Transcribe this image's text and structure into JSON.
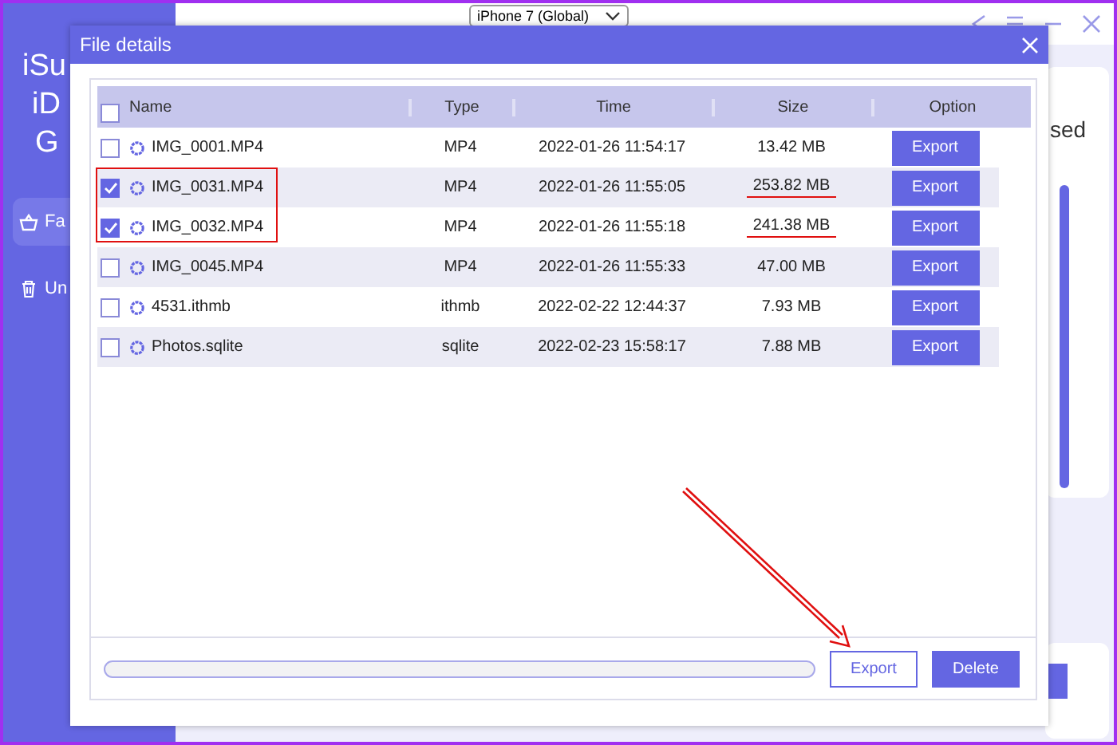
{
  "app": {
    "title_lines": [
      "iSu",
      "iD",
      "G"
    ],
    "sidebar": {
      "items": [
        {
          "label": "Fa",
          "kind": "basket",
          "selected": true
        },
        {
          "label": "Un",
          "kind": "trash",
          "selected": false
        }
      ]
    },
    "device_select": {
      "value": "iPhone 7 (Global)"
    },
    "side_text": "sed"
  },
  "dialog": {
    "title": "File details",
    "columns": [
      "Name",
      "Type",
      "Time",
      "Size",
      "Option"
    ],
    "select_all": {
      "checked": false
    },
    "rows": [
      {
        "name": "IMG_0001.MP4",
        "type": "MP4",
        "time": "2022-01-26 11:54:17",
        "size": "13.42 MB",
        "action": "Export",
        "checked": false,
        "underlined": false
      },
      {
        "name": "IMG_0031.MP4",
        "type": "MP4",
        "time": "2022-01-26 11:55:05",
        "size": "253.82 MB",
        "action": "Export",
        "checked": true,
        "underlined": true
      },
      {
        "name": "IMG_0032.MP4",
        "type": "MP4",
        "time": "2022-01-26 11:55:18",
        "size": "241.38 MB",
        "action": "Export",
        "checked": true,
        "underlined": true
      },
      {
        "name": "IMG_0045.MP4",
        "type": "MP4",
        "time": "2022-01-26 11:55:33",
        "size": "47.00 MB",
        "action": "Export",
        "checked": false,
        "underlined": false
      },
      {
        "name": "4531.ithmb",
        "type": "ithmb",
        "time": "2022-02-22 12:44:37",
        "size": "7.93 MB",
        "action": "Export",
        "checked": false,
        "underlined": false
      },
      {
        "name": "Photos.sqlite",
        "type": "sqlite",
        "time": "2022-02-23 15:58:17",
        "size": "7.88 MB",
        "action": "Export",
        "checked": false,
        "underlined": false
      }
    ],
    "progress": {
      "level": 0
    },
    "buttons": [
      {
        "label": "Export",
        "kind": "outline"
      },
      {
        "label": "Delete",
        "kind": "filled"
      }
    ]
  }
}
